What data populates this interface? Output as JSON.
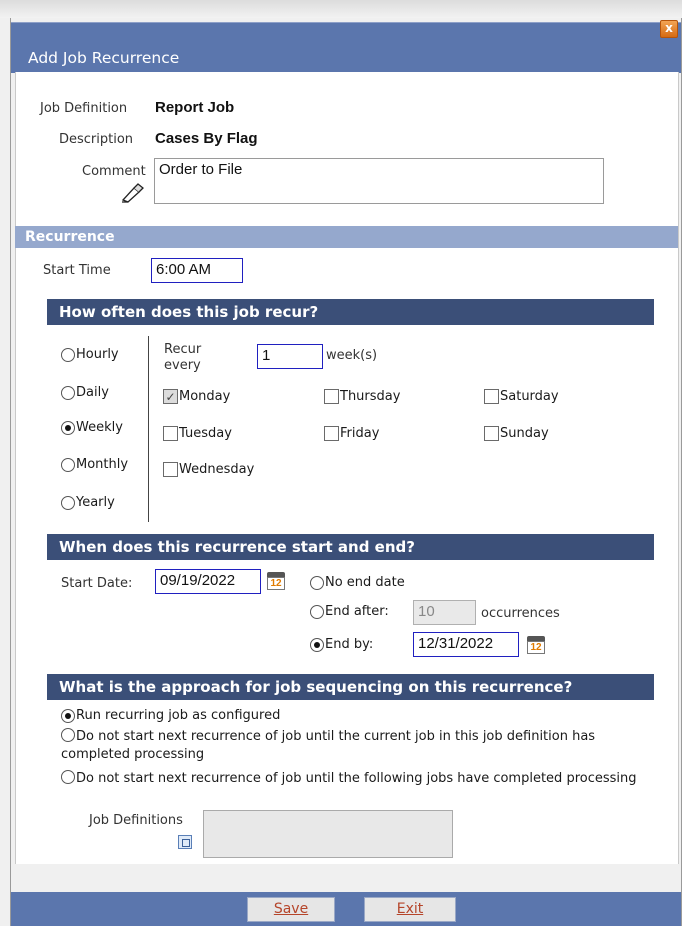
{
  "window": {
    "title": "Add Job Recurrence",
    "close_glyph": "x"
  },
  "job": {
    "definition_label": "Job Definition",
    "definition_value": "Report Job",
    "description_label": "Description",
    "description_value": "Cases By Flag",
    "comment_label": "Comment",
    "comment_value": "Order to File"
  },
  "recurrence": {
    "section_title": "Recurrence",
    "start_time_label": "Start Time",
    "start_time_value": "6:00 AM"
  },
  "frequency": {
    "title": "How often does this job recur?",
    "options": [
      {
        "label": "Hourly",
        "selected": false
      },
      {
        "label": "Daily",
        "selected": false
      },
      {
        "label": "Weekly",
        "selected": true
      },
      {
        "label": "Monthly",
        "selected": false
      },
      {
        "label": "Yearly",
        "selected": false
      }
    ],
    "recur_every_label": "Recur every",
    "recur_every_value": "1",
    "unit": "week(s)",
    "days": [
      {
        "label": "Monday",
        "checked": true
      },
      {
        "label": "Thursday",
        "checked": false
      },
      {
        "label": "Saturday",
        "checked": false
      },
      {
        "label": "Tuesday",
        "checked": false
      },
      {
        "label": "Friday",
        "checked": false
      },
      {
        "label": "Sunday",
        "checked": false
      },
      {
        "label": "Wednesday",
        "checked": false
      }
    ]
  },
  "range": {
    "title": "When does this recurrence start and end?",
    "start_date_label": "Start Date:",
    "start_date_value": "09/19/2022",
    "calendar_num": "12",
    "no_end_label": "No end date",
    "end_after_label": "End after:",
    "end_after_value": "10",
    "occurrences_label": "occurrences",
    "end_by_label": "End by:",
    "end_by_value": "12/31/2022",
    "selected": "end_by"
  },
  "sequencing": {
    "title": "What is the approach for job sequencing on this recurrence?",
    "option1": "Run recurring job as configured",
    "option2": "Do not start next recurrence of job until the current job in this job definition has completed processing",
    "option3": "Do not start next recurrence of job until the following jobs have completed processing",
    "job_definitions_label": "Job Definitions"
  },
  "footer": {
    "save_label": "Save",
    "exit_label": "Exit"
  },
  "colors": {
    "title_bar": "#5b76ad",
    "section_bar": "#95a8cd",
    "sub_bar": "#3b4f78",
    "button_text": "#b5452a"
  }
}
